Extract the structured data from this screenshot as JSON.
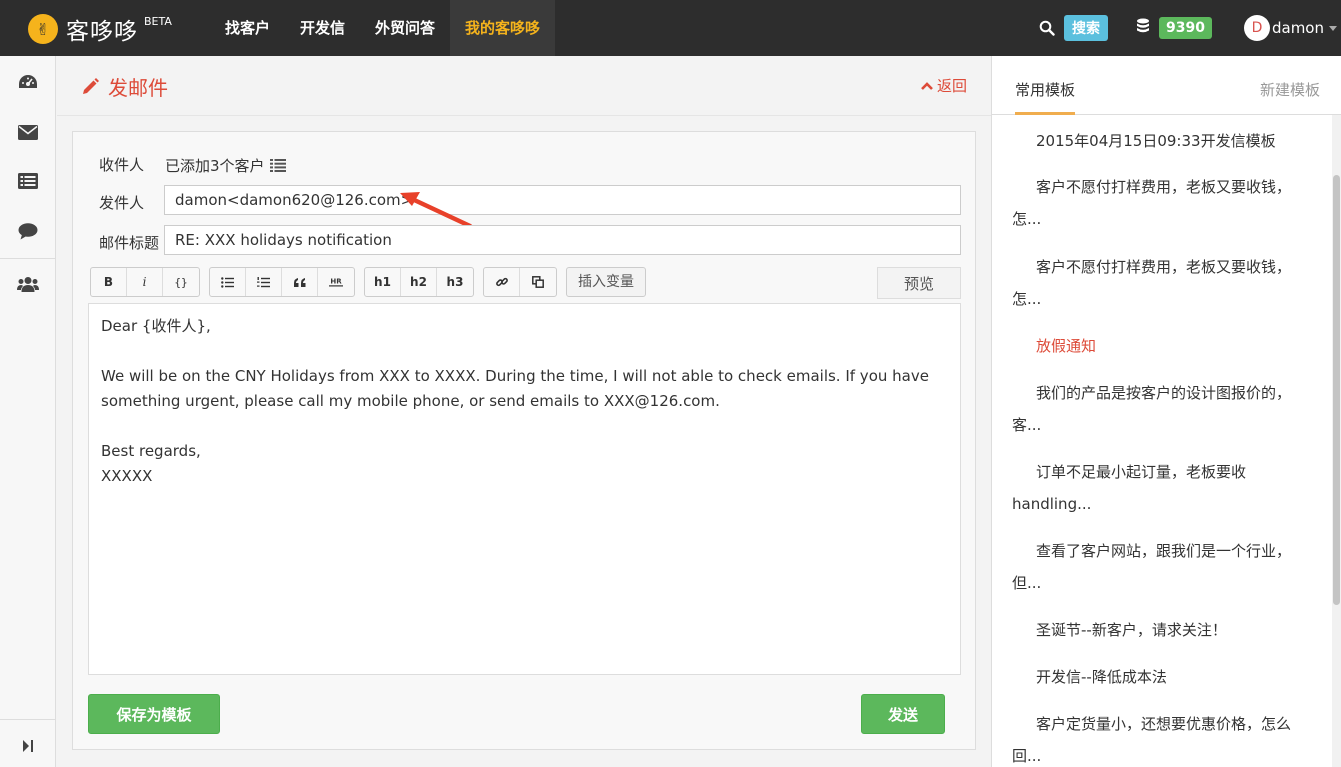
{
  "app": {
    "name": "客哆哆",
    "beta": "BETA",
    "logo_glyph": "✌"
  },
  "nav": {
    "items": [
      {
        "label": "找客户"
      },
      {
        "label": "开发信"
      },
      {
        "label": "外贸问答"
      },
      {
        "label": "我的客哆哆",
        "active": true
      }
    ],
    "search_label": "搜索",
    "points": "9390",
    "user": {
      "initial": "D",
      "name": "damon"
    }
  },
  "sidebar_icons": [
    "dashboard-icon",
    "envelope-icon",
    "list-icon",
    "comment-icon",
    "users-icon",
    "collapse-icon"
  ],
  "page": {
    "title": "发邮件",
    "back_label": "返回"
  },
  "form": {
    "recipient_label": "收件人",
    "recipient_value": "已添加3个客户",
    "sender_label": "发件人",
    "sender_value": "damon<damon620@126.com>",
    "subject_label": "邮件标题",
    "subject_value": "RE: XXX holidays notification"
  },
  "toolbar": {
    "group1": [
      "B",
      "i",
      "{}"
    ],
    "group3": [
      "h1",
      "h2",
      "h3"
    ],
    "insert_variable": "插入变量",
    "preview": "预览"
  },
  "editor": {
    "lines": [
      "Dear {收件人},",
      "",
      "We will be on the CNY Holidays from XXX to XXXX. During the time, I will not able to check emails. If you have",
      "something urgent, please call my mobile phone, or send emails to XXX@126.com.",
      "",
      "Best regards,",
      "XXXXX"
    ]
  },
  "buttons": {
    "save_template": "保存为模板",
    "send": "发送"
  },
  "templates_panel": {
    "tab_common": "常用模板",
    "tab_new": "新建模板",
    "items": [
      {
        "lines": [
          "2015年04月15日09:33开发信模板"
        ]
      },
      {
        "lines": [
          "客户不愿付打样费用，老板又要收钱，",
          "怎..."
        ]
      },
      {
        "lines": [
          "客户不愿付打样费用，老板又要收钱，",
          "怎..."
        ]
      },
      {
        "lines": [
          "放假通知"
        ],
        "highlight": true
      },
      {
        "lines": [
          "我们的产品是按客户的设计图报价的，",
          "客..."
        ]
      },
      {
        "lines": [
          "订单不足最小起订量，老板要收",
          "handling..."
        ]
      },
      {
        "lines": [
          "查看了客户网站，跟我们是一个行业，",
          "但..."
        ]
      },
      {
        "lines": [
          "圣诞节--新客户，请求关注！"
        ]
      },
      {
        "lines": [
          "开发信--降低成本法"
        ]
      },
      {
        "lines": [
          "客户定货量小，还想要优惠价格，怎么",
          "回..."
        ]
      }
    ]
  },
  "colors": {
    "accent_red": "#dd4b39",
    "nav_bg": "#2d2d2d",
    "active_nav": "#f5b31c",
    "green": "#5cb85c",
    "info": "#5bc0de"
  }
}
